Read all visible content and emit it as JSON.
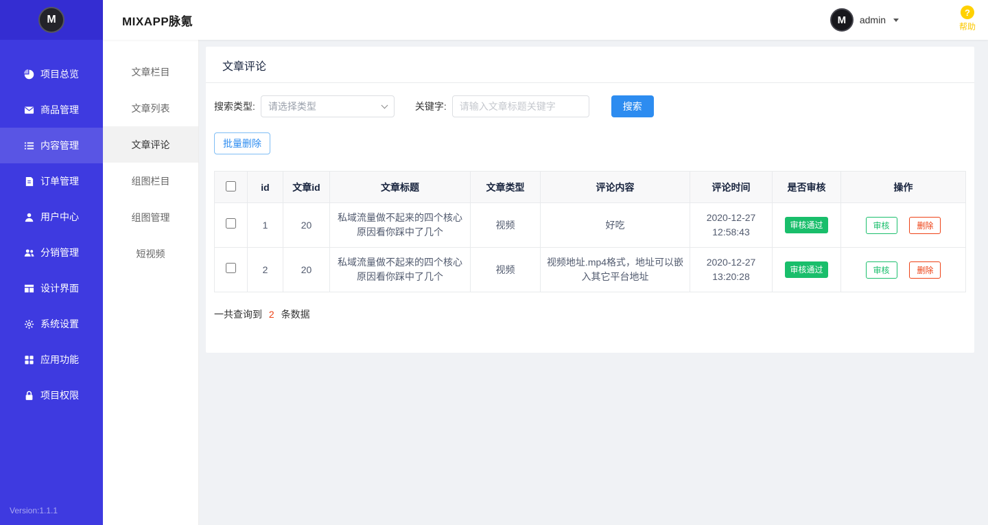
{
  "header": {
    "title": "MIXAPP脉氪",
    "logo_letter": "M",
    "username": "admin",
    "help_label": "帮助",
    "help_mark": "?"
  },
  "sidebar": {
    "version": "Version:1.1.1",
    "items": [
      {
        "label": "项目总览",
        "icon": "pie-chart-icon",
        "active": false
      },
      {
        "label": "商品管理",
        "icon": "mail-icon",
        "active": false
      },
      {
        "label": "内容管理",
        "icon": "list-icon",
        "active": true
      },
      {
        "label": "订单管理",
        "icon": "document-icon",
        "active": false
      },
      {
        "label": "用户中心",
        "icon": "user-icon",
        "active": false
      },
      {
        "label": "分销管理",
        "icon": "users-icon",
        "active": false
      },
      {
        "label": "设计界面",
        "icon": "layout-icon",
        "active": false
      },
      {
        "label": "系统设置",
        "icon": "gear-icon",
        "active": false
      },
      {
        "label": "应用功能",
        "icon": "apps-icon",
        "active": false
      },
      {
        "label": "项目权限",
        "icon": "lock-icon",
        "active": false
      }
    ]
  },
  "submenu": {
    "items": [
      {
        "label": "文章栏目",
        "active": false
      },
      {
        "label": "文章列表",
        "active": false
      },
      {
        "label": "文章评论",
        "active": true
      },
      {
        "label": "组图栏目",
        "active": false
      },
      {
        "label": "组图管理",
        "active": false
      },
      {
        "label": "短视频",
        "active": false
      }
    ]
  },
  "main": {
    "page_title": "文章评论",
    "search": {
      "type_label": "搜索类型:",
      "type_value": "请选择类型",
      "keyword_label": "关键字:",
      "keyword_placeholder": "请输入文章标题关键字",
      "search_button": "搜索"
    },
    "batch_delete_button": "批量删除",
    "table": {
      "headers": [
        "id",
        "文章id",
        "文章标题",
        "文章类型",
        "评论内容",
        "评论时间",
        "是否审核",
        "操作"
      ],
      "actions": {
        "audit": "审核",
        "delete": "删除"
      },
      "rows": [
        {
          "id": "1",
          "article_id": "20",
          "title": "私域流量做不起来的四个核心原因看你踩中了几个",
          "type": "视频",
          "content": "好吃",
          "time": "2020-12-27 12:58:43",
          "status": "审核通过"
        },
        {
          "id": "2",
          "article_id": "20",
          "title": "私域流量做不起来的四个核心原因看你踩中了几个",
          "type": "视频",
          "content": "视频地址.mp4格式，地址可以嵌入其它平台地址",
          "time": "2020-12-27 13:20:28",
          "status": "审核通过"
        }
      ]
    },
    "summary": {
      "prefix": "一共查询到",
      "count": "2",
      "suffix": "条数据"
    }
  },
  "colors": {
    "sidebar": "#3e3ae0",
    "primary": "#2d8cf0",
    "success": "#19be6b",
    "danger": "#ed4014",
    "help_yellow": "#ffd100"
  }
}
